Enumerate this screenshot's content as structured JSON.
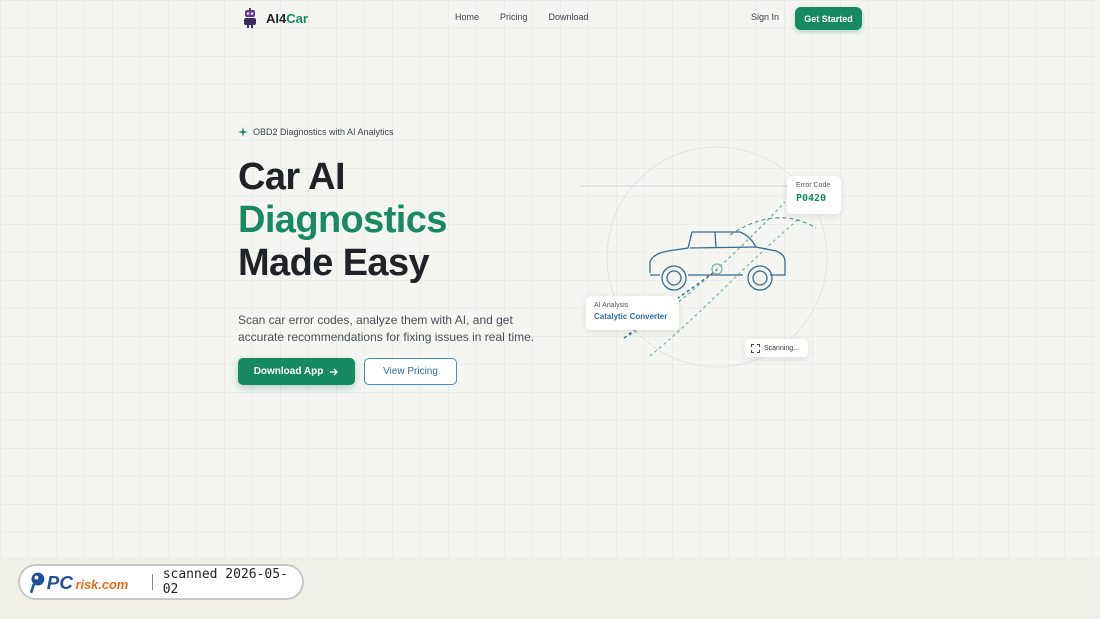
{
  "brand": {
    "name_prefix": "AI4",
    "name_suffix": "Car",
    "accent": "#178a63"
  },
  "nav": {
    "items": [
      {
        "label": "Home"
      },
      {
        "label": "Pricing"
      },
      {
        "label": "Download"
      }
    ]
  },
  "auth": {
    "signin_label": "Sign In",
    "cta_label": "Get Started"
  },
  "hero": {
    "badge": "OBD2 Diagnostics with AI Analytics",
    "title_line1": "Car AI",
    "title_line2": "Diagnostics",
    "title_line3": "Made Easy",
    "description": "Scan car error codes, analyze them with AI, and get accurate recommendations for fixing issues in real time.",
    "primary_button": "Download App",
    "secondary_button": "View Pricing"
  },
  "illustration": {
    "error_card": {
      "label": "Error Code",
      "value": "P0420"
    },
    "ai_card": {
      "label": "AI Analysis",
      "value": "Catalytic Converter"
    },
    "scan_status": "Scanning..."
  },
  "watermark": {
    "brand_main": "PC",
    "brand_rest": "risk.com",
    "text": "scanned 2026-05-02"
  }
}
